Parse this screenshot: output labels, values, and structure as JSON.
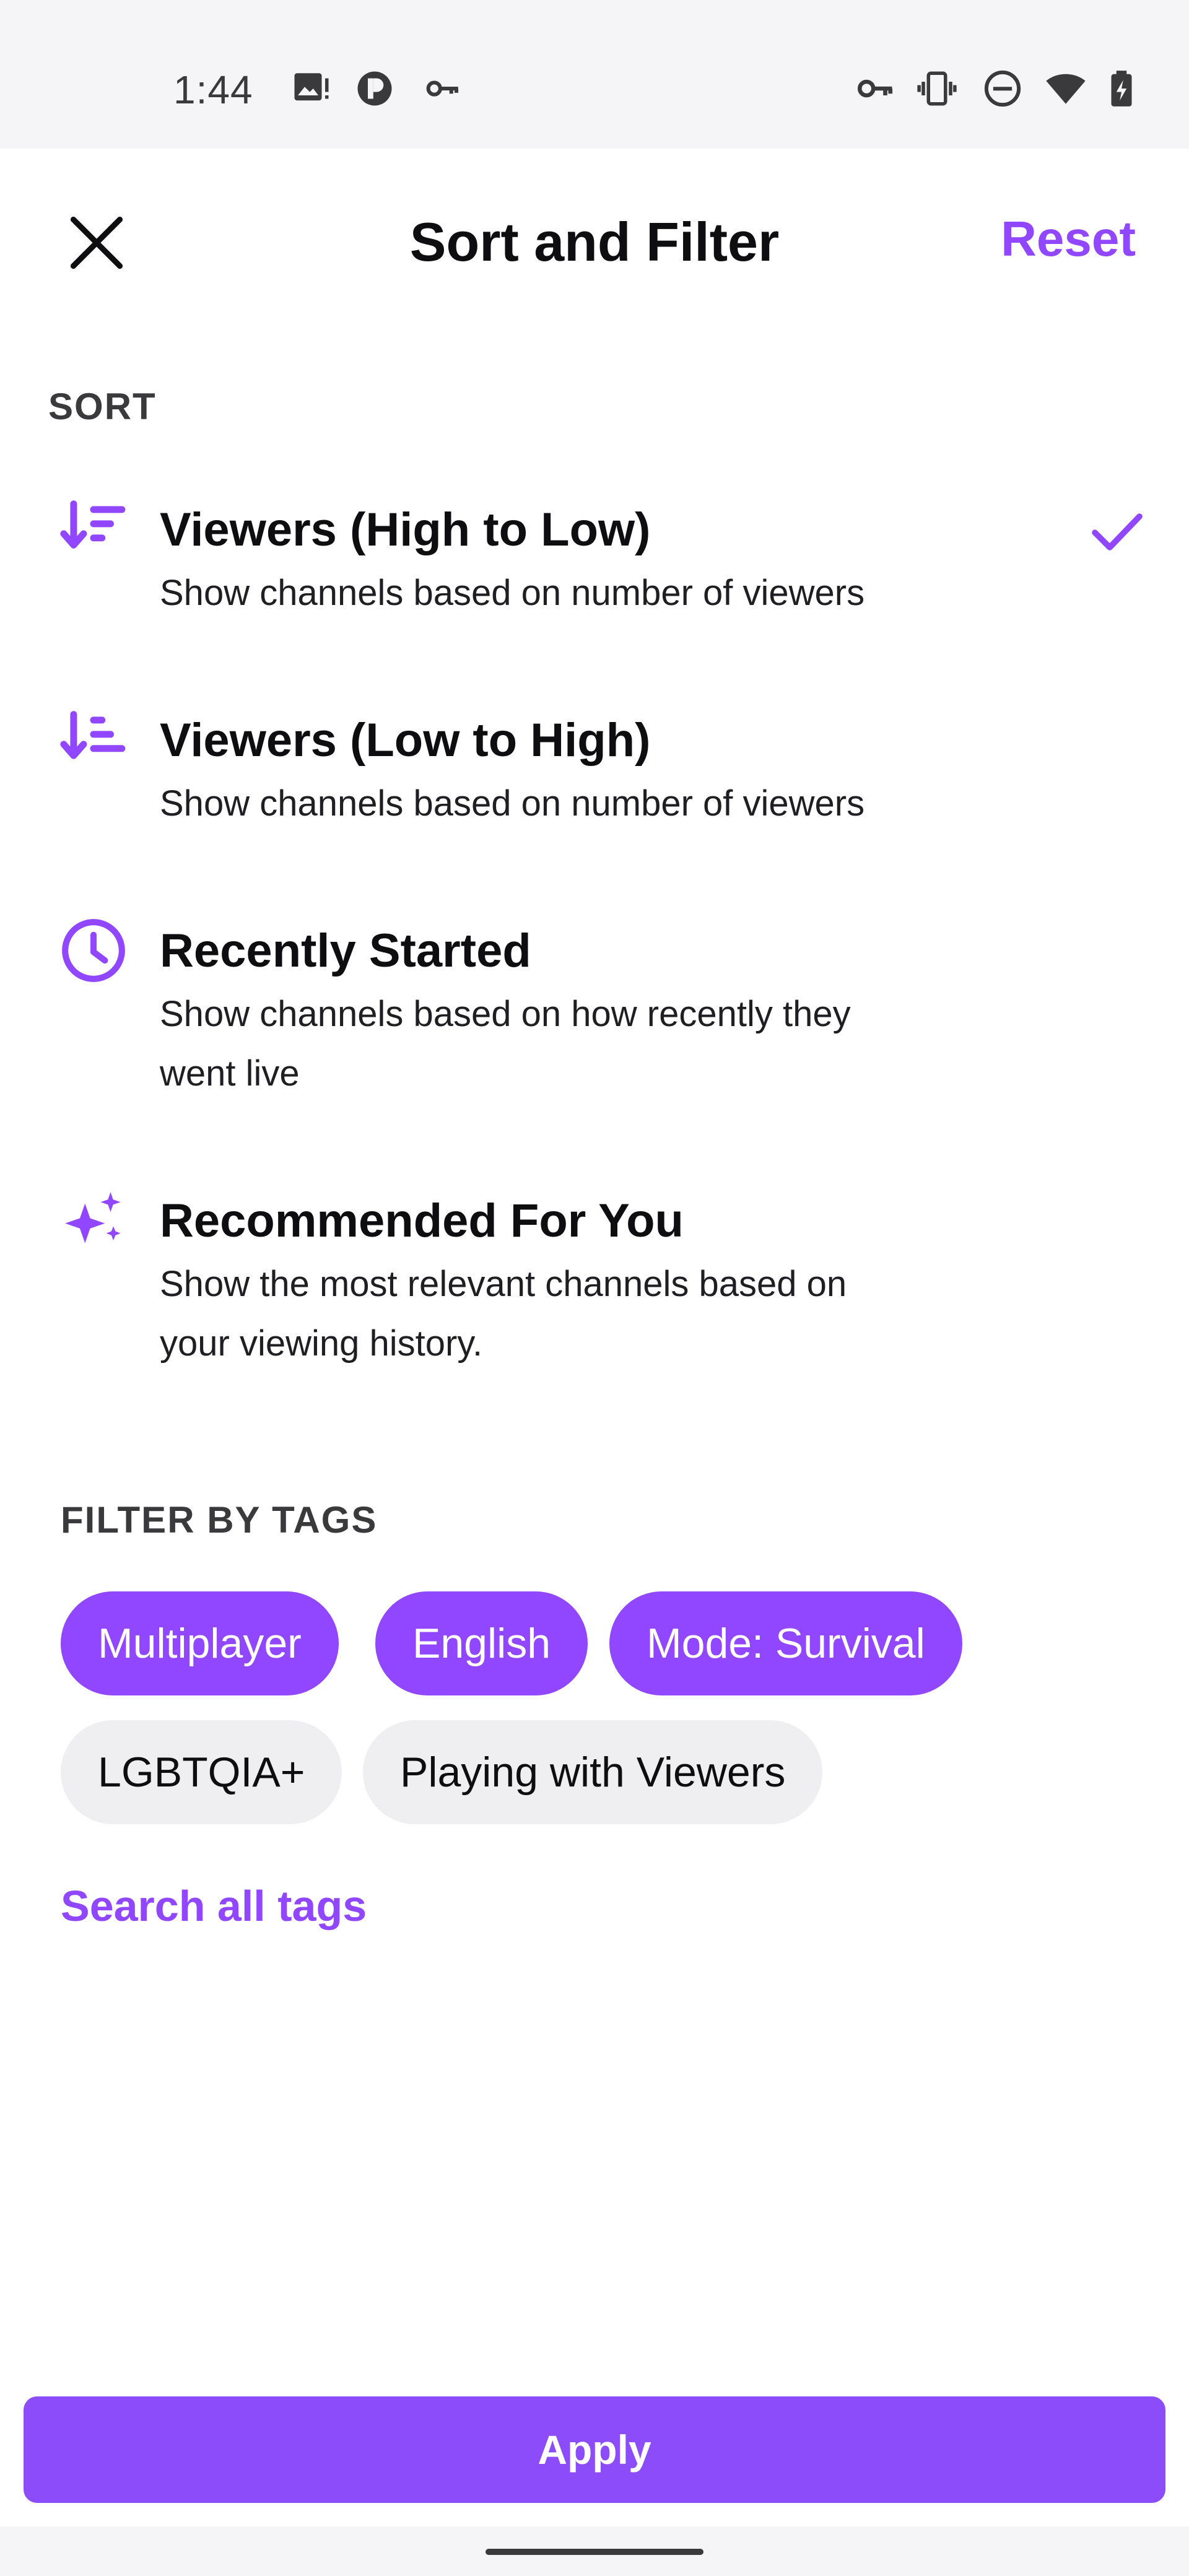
{
  "status_bar": {
    "time": "1:44",
    "left_icons": [
      "image-alert-icon",
      "t-app-icon",
      "key-icon"
    ],
    "right_icons": [
      "vpn-key-icon",
      "vibrate-icon",
      "do-not-disturb-icon",
      "wifi-icon",
      "battery-charging-icon"
    ]
  },
  "header": {
    "title": "Sort and Filter",
    "reset_label": "Reset",
    "close_icon": "close-icon"
  },
  "sort": {
    "label": "SORT",
    "items": [
      {
        "title": "Viewers (High to Low)",
        "description": "Show channels based on number of viewers",
        "icon": "sort-descending-icon",
        "selected": true
      },
      {
        "title": "Viewers (Low to High)",
        "description": "Show channels based on number of viewers",
        "icon": "sort-ascending-icon",
        "selected": false
      },
      {
        "title": "Recently Started",
        "description_line1": "Show channels based on how recently they",
        "description_line2": "went live",
        "icon": "clock-icon",
        "selected": false
      },
      {
        "title": "Recommended For You",
        "description_line1": "Show the most relevant channels based on",
        "description_line2": "your viewing history.",
        "icon": "sparkle-icon",
        "selected": false
      }
    ]
  },
  "filter": {
    "label": "FILTER BY TAGS",
    "tags": [
      {
        "label": "Multiplayer",
        "selected": true
      },
      {
        "label": "English",
        "selected": true
      },
      {
        "label": "Mode: Survival",
        "selected": true
      },
      {
        "label": "LGBTQIA+",
        "selected": false
      },
      {
        "label": "Playing with Viewers",
        "selected": false
      }
    ],
    "search_all_label": "Search all tags"
  },
  "footer": {
    "apply_label": "Apply"
  },
  "colors": {
    "accent": "#9147ff",
    "apply_button": "#8c4cf9",
    "chip_off": "#efeff1",
    "text": "#0e0e10"
  }
}
